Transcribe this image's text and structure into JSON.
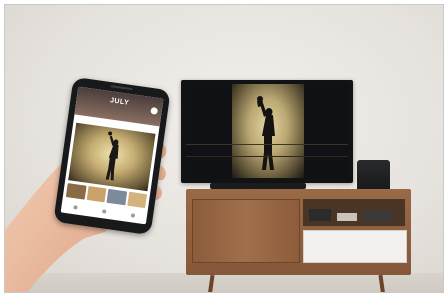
{
  "scene": {
    "phone": {
      "header": {
        "title": "JULY",
        "subtitle": ""
      },
      "caption": "",
      "icons": {
        "cast": "cast-icon"
      }
    }
  },
  "colors": {
    "wall": "#e6e2dd",
    "cabinet_wood": "#9a6a47",
    "tv_frame": "#111214",
    "photo_glow": "#e4d6a3"
  }
}
